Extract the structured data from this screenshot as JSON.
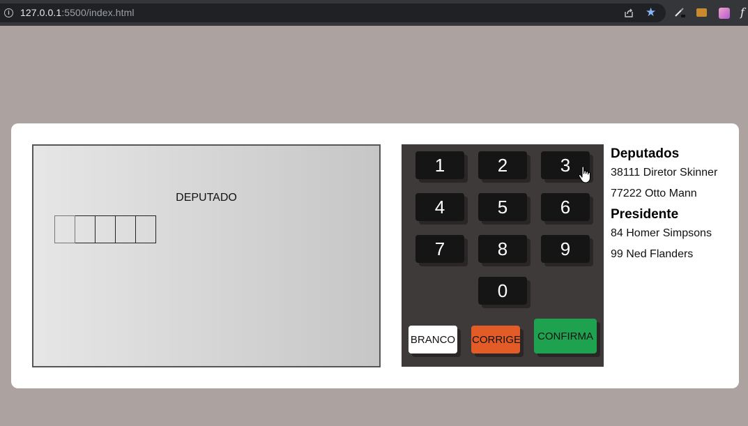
{
  "browser": {
    "url_host": "127.0.0.1",
    "url_rest": ":5500/index.html"
  },
  "screen": {
    "title": "DEPUTADO",
    "digit_count": 5
  },
  "keypad": {
    "keys": [
      "1",
      "2",
      "3",
      "4",
      "5",
      "6",
      "7",
      "8",
      "9",
      "0"
    ],
    "branco": "BRANCO",
    "corrige": "CORRIGE",
    "confirma": "CONFIRMA",
    "colors": {
      "branco": "#ffffff",
      "corrige": "#e35b26",
      "confirma": "#1fa24f"
    }
  },
  "sidebar": {
    "deputados_heading": "Deputados",
    "deputados": [
      "38111 Diretor Skinner",
      "77222 Otto Mann"
    ],
    "presidente_heading": "Presidente",
    "presidentes": [
      "84 Homer Simpsons",
      "99 Ned Flanders"
    ]
  }
}
